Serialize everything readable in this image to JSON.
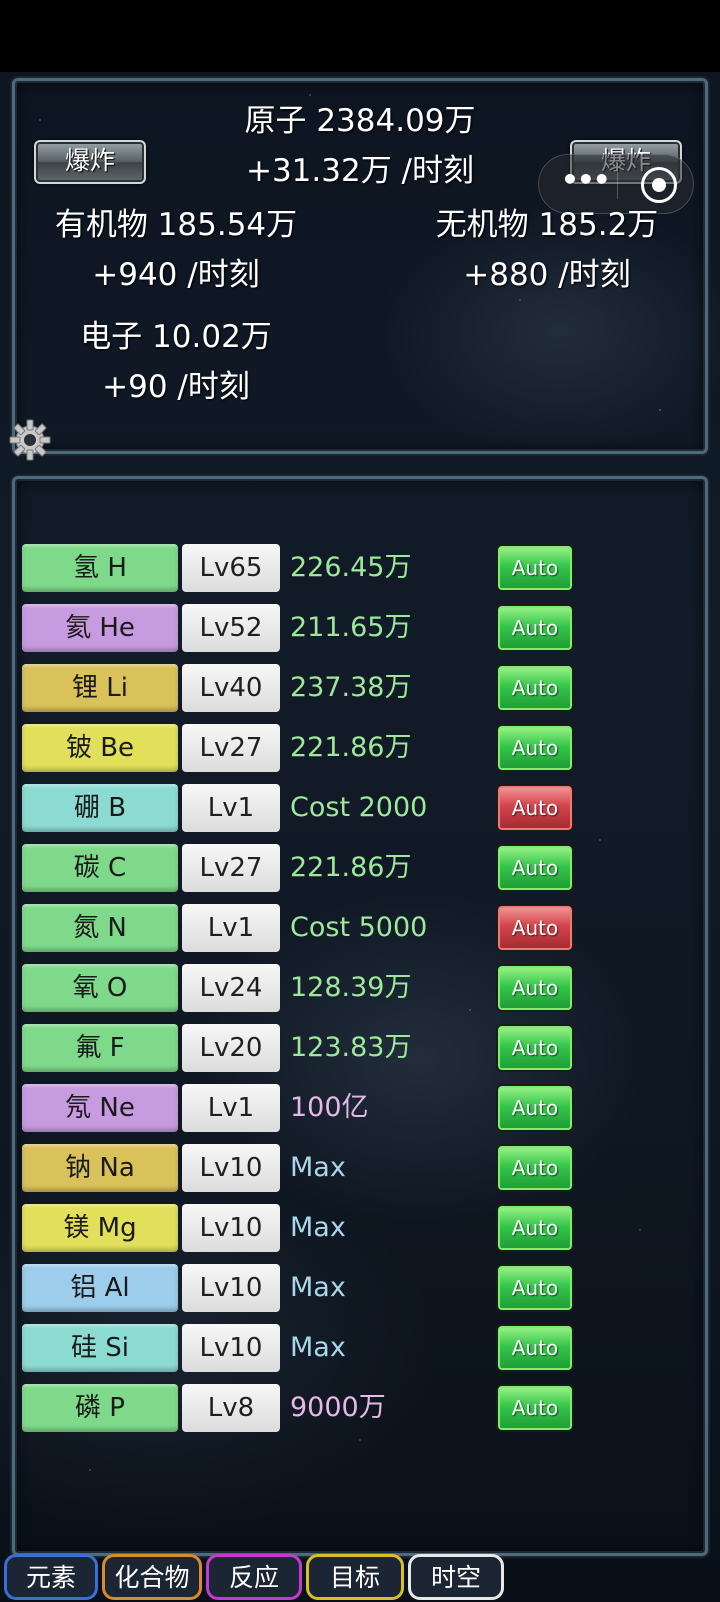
{
  "header": {
    "atoms": {
      "label": "原子 2384.09万",
      "rate": "+31.32万 /时刻"
    },
    "organic": {
      "label": "有机物 185.54万",
      "rate": "+940 /时刻"
    },
    "inorganic": {
      "label": "无机物 185.2万",
      "rate": "+880 /时刻"
    },
    "electrons": {
      "label": "电子 10.02万",
      "rate": "+90 /时刻"
    },
    "explode_left": "爆炸",
    "explode_right": "爆炸",
    "capsule": {
      "more": "•••",
      "more_icon": "more-dots-icon",
      "close_icon": "target-circle-icon"
    },
    "settings_icon": "gear-icon"
  },
  "colors": {
    "green": "#7fd98a",
    "purple": "#c79be0",
    "gold": "#d9c25a",
    "yellow": "#e2e05a",
    "teal": "#8cdbd2",
    "blue": "#9ccdea",
    "value_green": "#9ee89a",
    "value_pink": "#e5b8e8",
    "value_cyan": "#a8d8ea"
  },
  "elements": [
    {
      "name": "氢 H",
      "level": "Lv65",
      "value": "226.45万",
      "color": "green",
      "value_color": "value_green",
      "auto": "Auto",
      "auto_state": "on"
    },
    {
      "name": "氦 He",
      "level": "Lv52",
      "value": "211.65万",
      "color": "purple",
      "value_color": "value_green",
      "auto": "Auto",
      "auto_state": "on"
    },
    {
      "name": "锂 Li",
      "level": "Lv40",
      "value": "237.38万",
      "color": "gold",
      "value_color": "value_green",
      "auto": "Auto",
      "auto_state": "on"
    },
    {
      "name": "铍 Be",
      "level": "Lv27",
      "value": "221.86万",
      "color": "yellow",
      "value_color": "value_green",
      "auto": "Auto",
      "auto_state": "on"
    },
    {
      "name": "硼 B",
      "level": "Lv1",
      "value": "Cost 2000",
      "color": "teal",
      "value_color": "value_green",
      "auto": "Auto",
      "auto_state": "off"
    },
    {
      "name": "碳 C",
      "level": "Lv27",
      "value": "221.86万",
      "color": "green",
      "value_color": "value_green",
      "auto": "Auto",
      "auto_state": "on"
    },
    {
      "name": "氮 N",
      "level": "Lv1",
      "value": "Cost 5000",
      "color": "green",
      "value_color": "value_green",
      "auto": "Auto",
      "auto_state": "off"
    },
    {
      "name": "氧 O",
      "level": "Lv24",
      "value": "128.39万",
      "color": "green",
      "value_color": "value_green",
      "auto": "Auto",
      "auto_state": "on"
    },
    {
      "name": "氟 F",
      "level": "Lv20",
      "value": "123.83万",
      "color": "green",
      "value_color": "value_green",
      "auto": "Auto",
      "auto_state": "on"
    },
    {
      "name": "氖 Ne",
      "level": "Lv1",
      "value": "100亿",
      "color": "purple",
      "value_color": "value_pink",
      "auto": "Auto",
      "auto_state": "on"
    },
    {
      "name": "钠 Na",
      "level": "Lv10",
      "value": "Max",
      "color": "gold",
      "value_color": "value_cyan",
      "auto": "Auto",
      "auto_state": "on"
    },
    {
      "name": "镁 Mg",
      "level": "Lv10",
      "value": "Max",
      "color": "yellow",
      "value_color": "value_cyan",
      "auto": "Auto",
      "auto_state": "on"
    },
    {
      "name": "铝 Al",
      "level": "Lv10",
      "value": "Max",
      "color": "blue",
      "value_color": "value_cyan",
      "auto": "Auto",
      "auto_state": "on"
    },
    {
      "name": "硅 Si",
      "level": "Lv10",
      "value": "Max",
      "color": "teal",
      "value_color": "value_cyan",
      "auto": "Auto",
      "auto_state": "on"
    },
    {
      "name": "磷 P",
      "level": "Lv8",
      "value": "9000万",
      "color": "green",
      "value_color": "value_pink",
      "auto": "Auto",
      "auto_state": "on"
    }
  ],
  "tabs": [
    {
      "label": "元素",
      "border": "#3b6fd6"
    },
    {
      "label": "化合物",
      "border": "#d98a2b"
    },
    {
      "label": "反应",
      "border": "#c23bd1"
    },
    {
      "label": "目标",
      "border": "#d6c02a"
    },
    {
      "label": "时空",
      "border": "#e8e8e8"
    }
  ]
}
